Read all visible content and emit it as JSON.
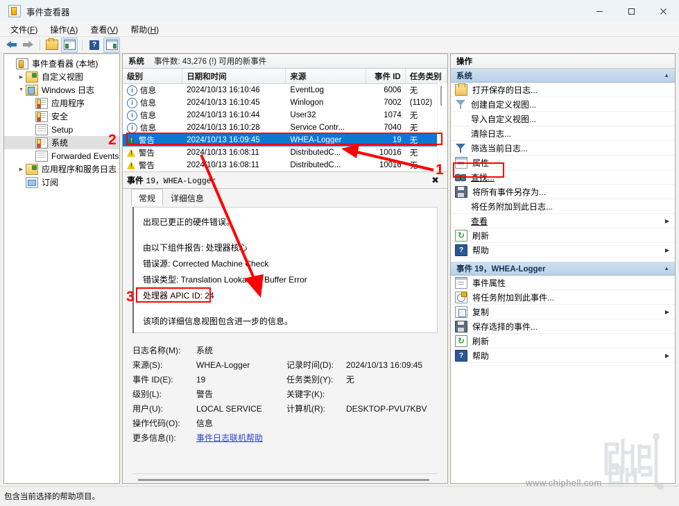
{
  "window": {
    "title": "事件查看器",
    "app_icon": "event-viewer-icon",
    "minimize": "─",
    "maximize": "☐",
    "close": "×"
  },
  "menubar": [
    {
      "label": "文件",
      "accel": "F"
    },
    {
      "label": "操作",
      "accel": "A"
    },
    {
      "label": "查看",
      "accel": "V"
    },
    {
      "label": "帮助",
      "accel": "H"
    }
  ],
  "toolbar": [
    {
      "name": "back-icon"
    },
    {
      "name": "forward-icon"
    },
    {
      "name": "separator"
    },
    {
      "name": "open-folder-icon"
    },
    {
      "name": "show-tree-pane-icon"
    },
    {
      "name": "separator"
    },
    {
      "name": "help-icon"
    },
    {
      "name": "show-action-pane-icon"
    }
  ],
  "tree": {
    "items": [
      {
        "label": "事件查看器 (本地)",
        "icon": "event-viewer-icon",
        "indent": 0,
        "chevron": "",
        "selected": false
      },
      {
        "label": "自定义视图",
        "icon": "custom-view-folder-icon",
        "indent": 1,
        "chevron": "›",
        "selected": false
      },
      {
        "label": "Windows 日志",
        "icon": "windows-logs-icon",
        "indent": 1,
        "chevron": "⌄",
        "selected": false
      },
      {
        "label": "应用程序",
        "icon": "log-marked-icon",
        "indent": 2,
        "chevron": "",
        "selected": false
      },
      {
        "label": "安全",
        "icon": "log-marked-icon",
        "indent": 2,
        "chevron": "",
        "selected": false
      },
      {
        "label": "Setup",
        "icon": "log-icon",
        "indent": 2,
        "chevron": "",
        "selected": false
      },
      {
        "label": "系统",
        "icon": "log-marked-icon",
        "indent": 2,
        "chevron": "",
        "selected": true
      },
      {
        "label": "Forwarded Events",
        "icon": "log-icon",
        "indent": 2,
        "chevron": "",
        "selected": false
      },
      {
        "label": "应用程序和服务日志",
        "icon": "app-service-logs-icon",
        "indent": 1,
        "chevron": "›",
        "selected": false
      },
      {
        "label": "订阅",
        "icon": "subscriptions-icon",
        "indent": 1,
        "chevron": "",
        "selected": false
      }
    ]
  },
  "list": {
    "header_log": "系统",
    "header_count": "事件数: 43,276 (!) 可用的新事件",
    "columns": [
      "级别",
      "日期和时间",
      "来源",
      "事件 ID",
      "任务类别"
    ],
    "rows": [
      {
        "level": "信息",
        "level_icon": "information-icon",
        "datetime": "2024/10/13 16:10:46",
        "source": "EventLog",
        "event_id": "6006",
        "task": "无",
        "selected": false
      },
      {
        "level": "信息",
        "level_icon": "information-icon",
        "datetime": "2024/10/13 16:10:45",
        "source": "Winlogon",
        "event_id": "7002",
        "task": "(1102)",
        "selected": false
      },
      {
        "level": "信息",
        "level_icon": "information-icon",
        "datetime": "2024/10/13 16:10:44",
        "source": "User32",
        "event_id": "1074",
        "task": "无",
        "selected": false
      },
      {
        "level": "信息",
        "level_icon": "information-icon",
        "datetime": "2024/10/13 16:10:28",
        "source": "Service Contr...",
        "event_id": "7040",
        "task": "无",
        "selected": false
      },
      {
        "level": "警告",
        "level_icon": "warning-icon",
        "datetime": "2024/10/13 16:09:45",
        "source": "WHEA-Logger",
        "event_id": "19",
        "task": "无",
        "selected": true
      },
      {
        "level": "警告",
        "level_icon": "warning-icon",
        "datetime": "2024/10/13 16:08:11",
        "source": "DistributedC...",
        "event_id": "10016",
        "task": "无",
        "selected": false
      },
      {
        "level": "警告",
        "level_icon": "warning-icon",
        "datetime": "2024/10/13 16:08:11",
        "source": "DistributedC...",
        "event_id": "10016",
        "task": "无",
        "selected": false
      }
    ]
  },
  "detail": {
    "title_prefix": "事件",
    "title_rest": "19，WHEA-Logger",
    "close": "✖",
    "tabs": [
      {
        "label": "常规",
        "active": true
      },
      {
        "label": "详细信息",
        "active": false
      }
    ],
    "message": {
      "line1": "出现已更正的硬件错误。",
      "line2": "由以下组件报告: 处理器核心",
      "line3": "错误源: Corrected Machine Check",
      "line4": "错误类型: Translation Lookaside Buffer Error",
      "line5": "处理器 APIC ID: 24",
      "line6": "该项的详细信息视图包含进一步的信息。"
    },
    "properties": [
      {
        "label": "日志名称(M):",
        "value": "系统",
        "label2": "",
        "value2": ""
      },
      {
        "label": "来源(S):",
        "value": "WHEA-Logger",
        "label2": "记录时间(D):",
        "value2": "2024/10/13 16:09:45"
      },
      {
        "label": "事件 ID(E):",
        "value": "19",
        "label2": "任务类别(Y):",
        "value2": "无"
      },
      {
        "label": "级别(L):",
        "value": "警告",
        "label2": "关键字(K):",
        "value2": ""
      },
      {
        "label": "用户(U):",
        "value": "LOCAL SERVICE",
        "label2": "计算机(R):",
        "value2": "DESKTOP-PVU7KBV"
      },
      {
        "label": "操作代码(O):",
        "value": "信息",
        "label2": "",
        "value2": ""
      }
    ],
    "more_info_label": "更多信息(I):",
    "more_info_link": "事件日志联机帮助"
  },
  "actions": {
    "header": "操作",
    "sections": [
      {
        "title": "系统",
        "caret": "▲",
        "items": [
          {
            "label": "打开保存的日志...",
            "icon": "open-saved-log-icon",
            "submenu": false,
            "underline": false
          },
          {
            "label": "创建自定义视图...",
            "icon": "create-custom-view-icon",
            "submenu": false,
            "underline": false
          },
          {
            "label": "导入自定义视图...",
            "icon": "none",
            "submenu": false,
            "underline": false
          },
          {
            "label": "清除日志...",
            "icon": "none",
            "submenu": false,
            "underline": false
          },
          {
            "label": "筛选当前日志...",
            "icon": "filter-icon",
            "submenu": false,
            "underline": false
          },
          {
            "label": "属性",
            "icon": "properties-icon",
            "submenu": false,
            "underline": false
          },
          {
            "label": "查找...",
            "icon": "find-icon",
            "submenu": false,
            "underline": true
          },
          {
            "label": "将所有事件另存为...",
            "icon": "save-icon",
            "submenu": false,
            "underline": false
          },
          {
            "label": "将任务附加到此日志...",
            "icon": "none",
            "submenu": false,
            "underline": false
          },
          {
            "label": "查看",
            "icon": "none",
            "submenu": true,
            "underline": true
          },
          {
            "label": "刷新",
            "icon": "refresh-icon",
            "submenu": false,
            "underline": false
          },
          {
            "label": "帮助",
            "icon": "help-icon",
            "submenu": true,
            "underline": false
          }
        ]
      },
      {
        "title": "事件 19，WHEA-Logger",
        "caret": "▲",
        "items": [
          {
            "label": "事件属性",
            "icon": "properties-icon",
            "submenu": false,
            "underline": false
          },
          {
            "label": "将任务附加到此事件...",
            "icon": "attach-task-icon",
            "submenu": false,
            "underline": false
          },
          {
            "label": "复制",
            "icon": "copy-icon",
            "submenu": true,
            "underline": false
          },
          {
            "label": "保存选择的事件...",
            "icon": "save-icon",
            "submenu": false,
            "underline": false
          },
          {
            "label": "刷新",
            "icon": "refresh-icon",
            "submenu": false,
            "underline": false
          },
          {
            "label": "帮助",
            "icon": "help-icon",
            "submenu": true,
            "underline": false
          }
        ]
      }
    ]
  },
  "statusbar": {
    "text": "包含当前选择的帮助项目。"
  },
  "annotations": [
    {
      "label": "1"
    },
    {
      "label": "2"
    },
    {
      "label": "3"
    }
  ],
  "watermark": {
    "url": "www.chiphell.com",
    "logo": "chiphell-logo"
  },
  "colors": {
    "selection": "#0f76d4",
    "annotation": "#ff0000",
    "section_header": "#b9d2ea",
    "link": "#2a3fd0"
  }
}
